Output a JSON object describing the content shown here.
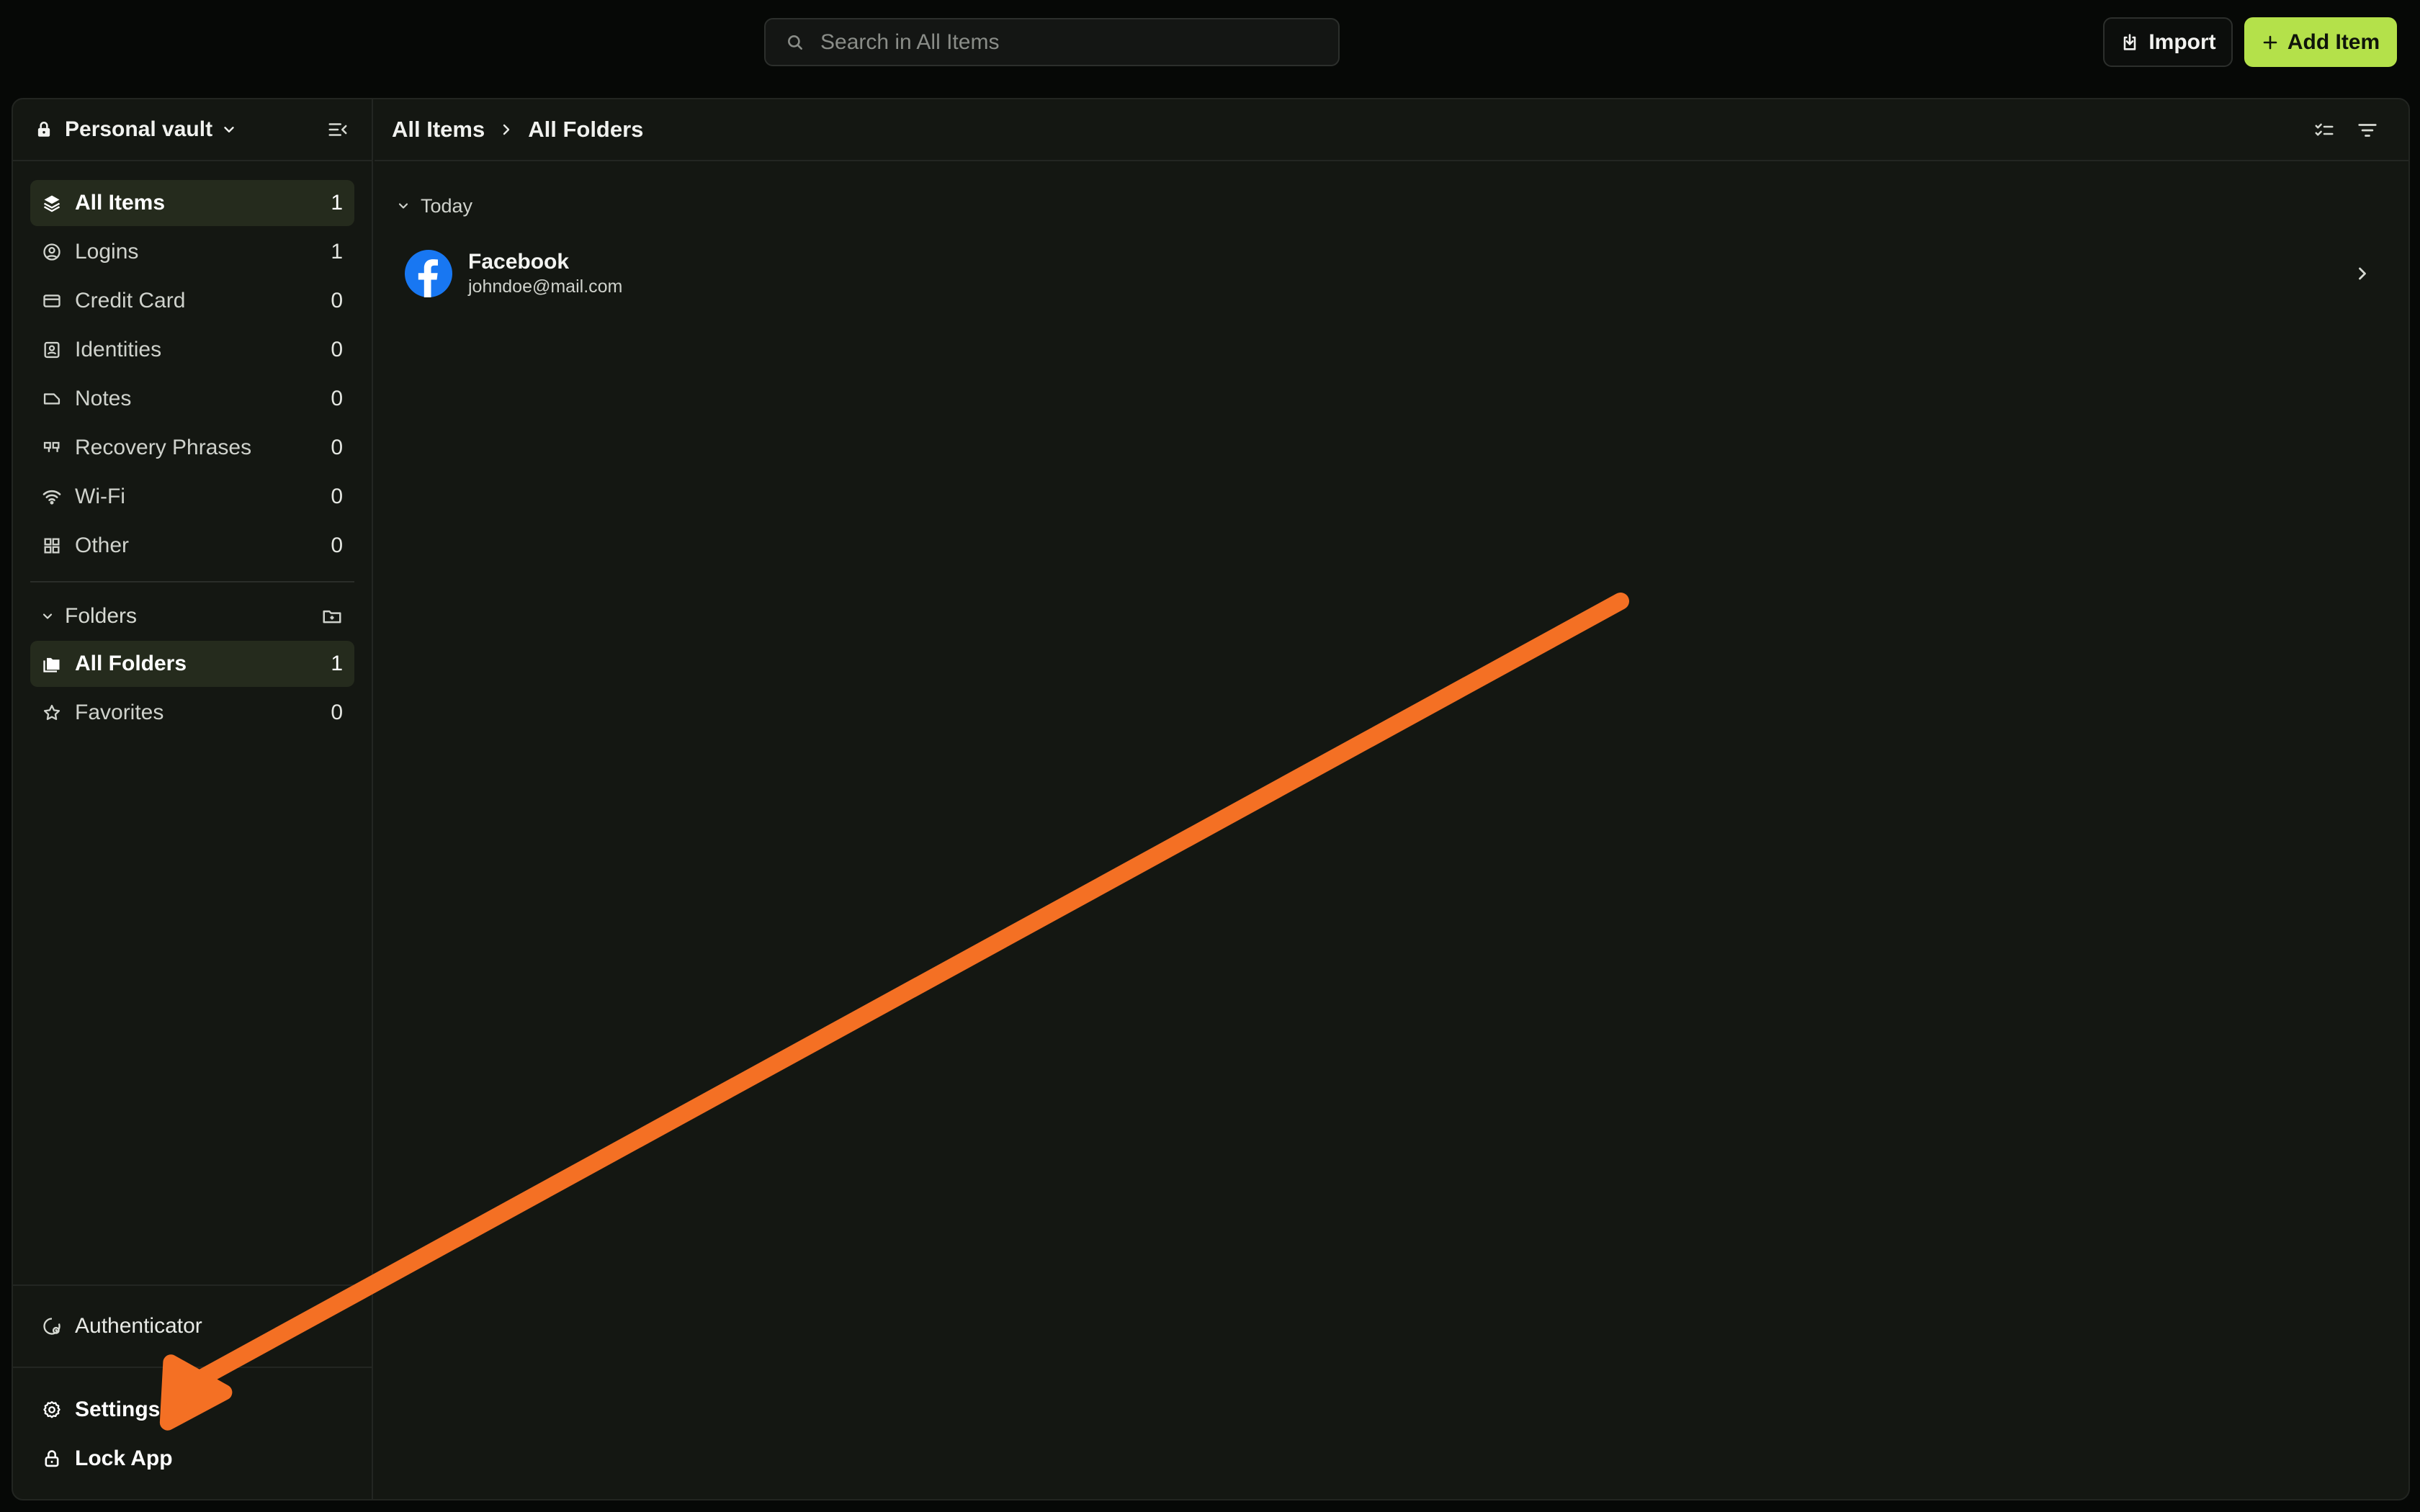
{
  "search": {
    "placeholder": "Search in All Items"
  },
  "toolbar": {
    "import_label": "Import",
    "add_label": "Add Item"
  },
  "sidebar": {
    "vault_name": "Personal vault",
    "items": [
      {
        "label": "All Items",
        "count": "1",
        "icon": "layers-icon"
      },
      {
        "label": "Logins",
        "count": "1",
        "icon": "user-circle-icon"
      },
      {
        "label": "Credit Card",
        "count": "0",
        "icon": "credit-card-icon"
      },
      {
        "label": "Identities",
        "count": "0",
        "icon": "id-badge-icon"
      },
      {
        "label": "Notes",
        "count": "0",
        "icon": "note-icon"
      },
      {
        "label": "Recovery Phrases",
        "count": "0",
        "icon": "quote-icon"
      },
      {
        "label": "Wi-Fi",
        "count": "0",
        "icon": "wifi-icon"
      },
      {
        "label": "Other",
        "count": "0",
        "icon": "grid-icon"
      }
    ],
    "folders_label": "Folders",
    "folders": [
      {
        "label": "All Folders",
        "count": "1",
        "icon": "folders-icon"
      },
      {
        "label": "Favorites",
        "count": "0",
        "icon": "star-icon"
      }
    ],
    "authenticator_label": "Authenticator",
    "settings_label": "Settings",
    "lock_label": "Lock App"
  },
  "breadcrumb": {
    "root": "All Items",
    "current": "All Folders"
  },
  "list": {
    "group_label": "Today",
    "entries": [
      {
        "title": "Facebook",
        "subtitle": "johndoe@mail.com",
        "icon": "facebook-icon"
      }
    ]
  },
  "colors": {
    "accent": "#b4e14a",
    "annotation_arrow": "#f47024",
    "facebook": "#1877f2"
  }
}
